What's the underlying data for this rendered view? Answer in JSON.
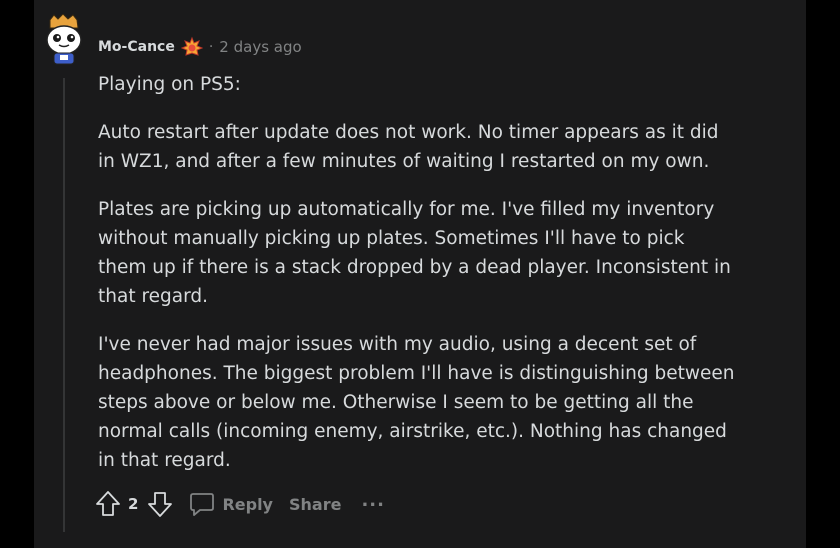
{
  "comment": {
    "author": "Mo-Cance",
    "separator": "·",
    "timestamp": "2 days ago",
    "paragraphs": [
      "Playing on PS5:",
      "Auto restart after update does not work. No timer appears as it did in WZ1, and after a few minutes of waiting I restarted on my own.",
      "Plates are picking up automatically for me. I've filled my inventory without manually picking up plates. Sometimes I'll have to pick them up if there is a stack dropped by a dead player. Inconsistent in that regard.",
      "I've never had major issues with my audio, using a decent set of headphones. The biggest problem I'll have is distinguishing between steps above or below me. Otherwise I seem to be getting all the normal calls (incoming enemy, airstrike, etc.). Nothing has changed in that regard."
    ],
    "vote_count": "2",
    "reply_label": "Reply",
    "share_label": "Share",
    "more_label": "..."
  },
  "icons": {
    "avatar": "snoo-avatar-icon",
    "badge": "achievement-badge-icon",
    "upvote": "arrow-up-icon",
    "downvote": "arrow-down-icon",
    "reply": "comment-bubble-icon",
    "more": "ellipsis-icon"
  },
  "colors": {
    "background": "#1a1a1b",
    "text": "#d7dadc",
    "muted": "#818384",
    "thread_line": "#343536"
  }
}
